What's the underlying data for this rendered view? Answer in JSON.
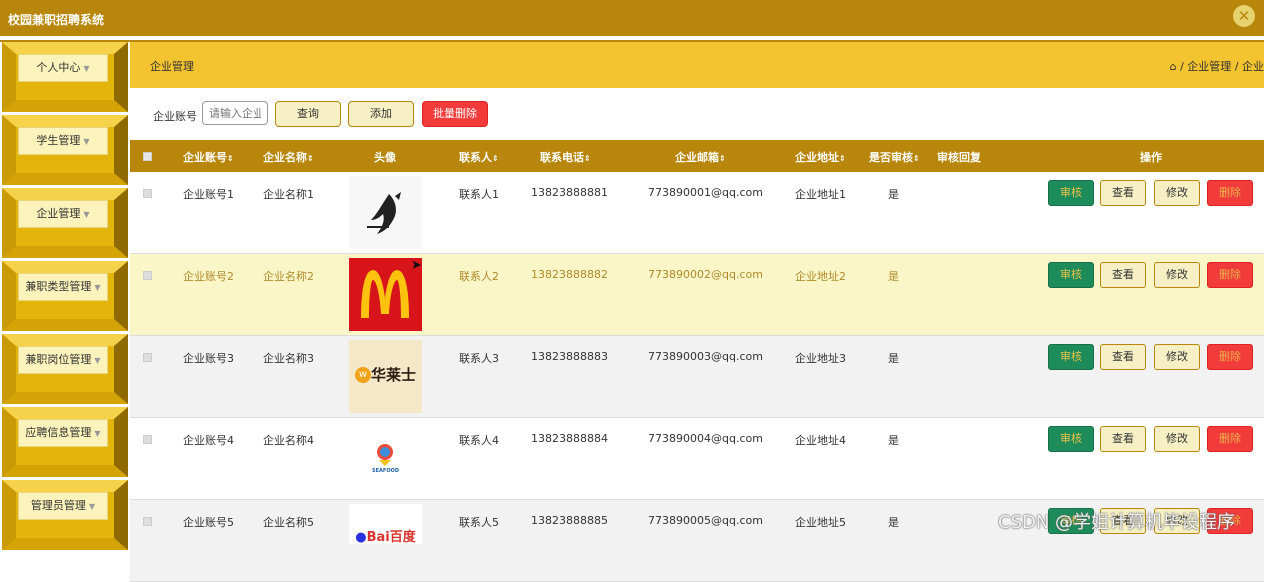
{
  "app": {
    "title": "校园兼职招聘系统"
  },
  "sidebar": {
    "items": [
      {
        "label": "个人中心"
      },
      {
        "label": "学生管理"
      },
      {
        "label": "企业管理"
      },
      {
        "label": "兼职类型管理"
      },
      {
        "label": "兼职岗位管理"
      },
      {
        "label": "应聘信息管理"
      },
      {
        "label": "管理员管理"
      }
    ]
  },
  "header": {
    "page_title": "企业管理",
    "breadcrumb": "/ 企业管理 / 企业"
  },
  "search": {
    "label": "企业账号",
    "placeholder": "请输入企业",
    "query_label": "查询",
    "add_label": "添加",
    "batch_delete_label": "批量删除"
  },
  "table": {
    "columns": {
      "account": "企业账号",
      "name": "企业名称",
      "avatar": "头像",
      "contact": "联系人",
      "phone": "联系电话",
      "email": "企业邮箱",
      "address": "企业地址",
      "reviewed": "是否审核",
      "reply": "审核回复",
      "actions": "操作"
    },
    "rows": [
      {
        "account": "企业账号1",
        "name": "企业名称1",
        "contact": "联系人1",
        "phone": "13823888881",
        "email": "773890001@qq.com",
        "address": "企业地址1",
        "reviewed": "是",
        "reply": ""
      },
      {
        "account": "企业账号2",
        "name": "企业名称2",
        "contact": "联系人2",
        "phone": "13823888882",
        "email": "773890002@qq.com",
        "address": "企业地址2",
        "reviewed": "是",
        "reply": ""
      },
      {
        "account": "企业账号3",
        "name": "企业名称3",
        "contact": "联系人3",
        "phone": "13823888883",
        "email": "773890003@qq.com",
        "address": "企业地址3",
        "reviewed": "是",
        "reply": ""
      },
      {
        "account": "企业账号4",
        "name": "企业名称4",
        "contact": "联系人4",
        "phone": "13823888884",
        "email": "773890004@qq.com",
        "address": "企业地址4",
        "reviewed": "是",
        "reply": ""
      },
      {
        "account": "企业账号5",
        "name": "企业名称5",
        "contact": "联系人5",
        "phone": "13823888885",
        "email": "773890005@qq.com",
        "address": "企业地址5",
        "reviewed": "是",
        "reply": ""
      }
    ],
    "actions": {
      "approve": "审核",
      "view": "查看",
      "edit": "修改",
      "delete": "删除"
    }
  },
  "logos": {
    "row3_text": "华莱士",
    "row4_text": "SEAFOOD",
    "row5_text": "Bai百度"
  },
  "watermark": "CSDN @学姐计算机毕设程序",
  "colors": {
    "primary": "#b8860b",
    "header": "#f4c430",
    "danger": "#f23b3b",
    "approve": "#1e8b5a",
    "highlight_row": "#fbf6c8"
  }
}
